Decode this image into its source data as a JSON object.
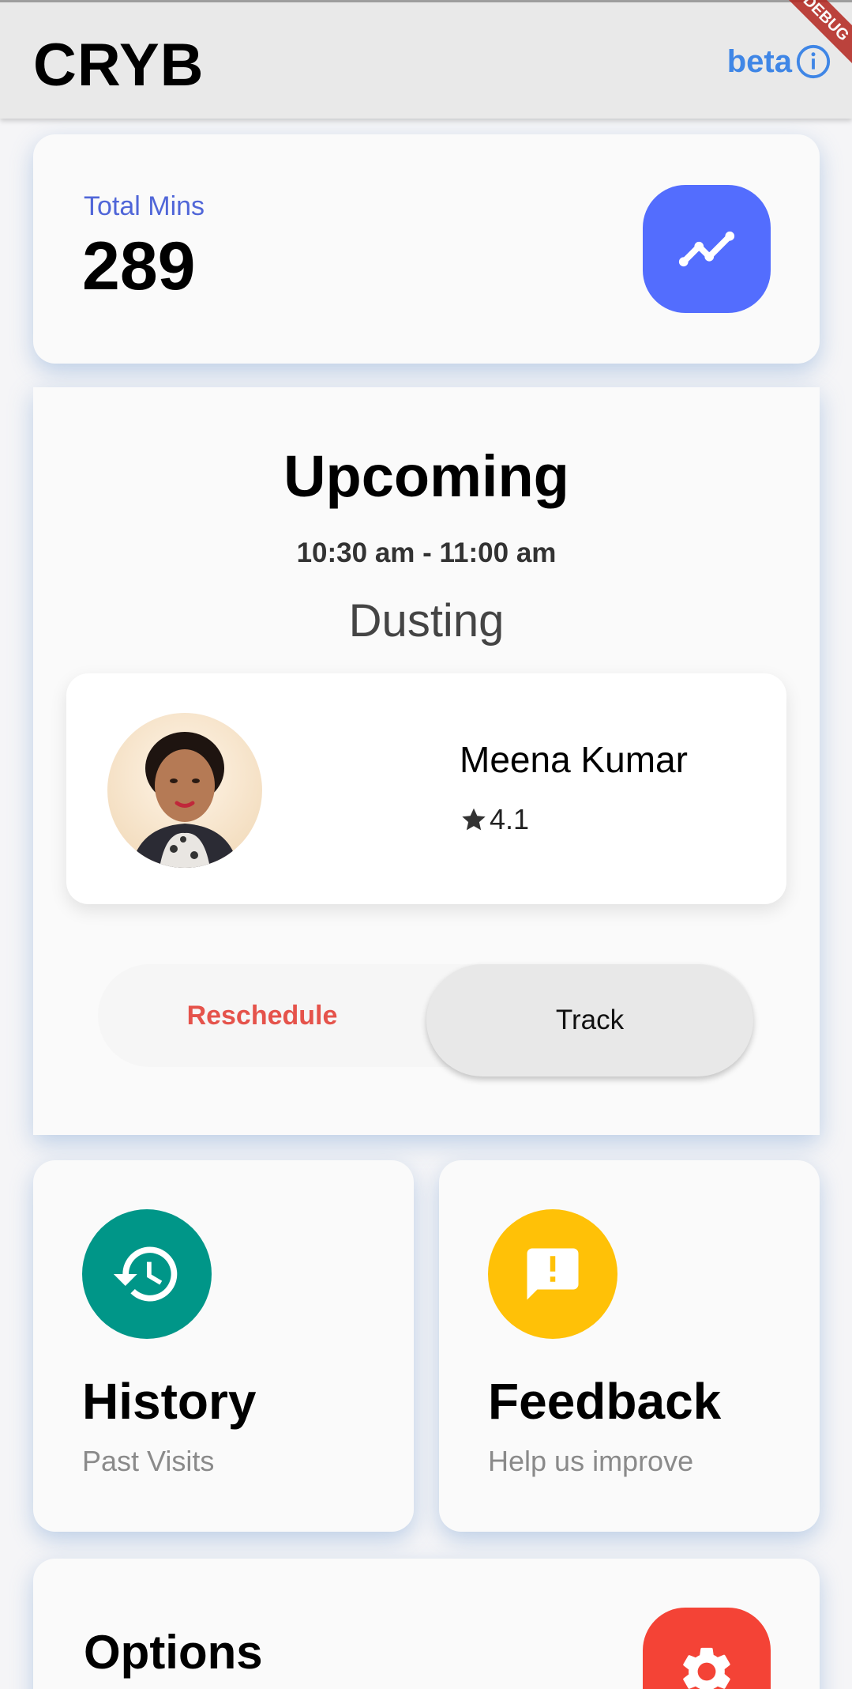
{
  "app": {
    "title": "CRYB",
    "beta_label": "beta",
    "debug_banner": "DEBUG"
  },
  "colors": {
    "accent_blue": "#536dfe",
    "beta_blue": "#3f86e6",
    "history_teal": "#009688",
    "feedback_amber": "#ffc107",
    "settings_red": "#f44336",
    "reschedule_red": "#e5534b"
  },
  "icons": {
    "info": "info-circle-icon",
    "trend": "trending-line-icon",
    "star": "star-icon",
    "history": "history-clock-icon",
    "feedback": "feedback-message-icon",
    "settings": "gear-icon"
  },
  "stats": {
    "total_mins_label": "Total Mins",
    "total_mins_value": "289"
  },
  "upcoming": {
    "title": "Upcoming",
    "time_range": "10:30 am - 11:00 am",
    "service": "Dusting",
    "provider": {
      "name": "Meena Kumar",
      "rating": "4.1"
    },
    "actions": {
      "reschedule_label": "Reschedule",
      "track_label": "Track"
    }
  },
  "tiles": [
    {
      "title": "History",
      "subtitle": "Past Visits"
    },
    {
      "title": "Feedback",
      "subtitle": "Help us improve"
    }
  ],
  "options": {
    "title": "Options"
  }
}
